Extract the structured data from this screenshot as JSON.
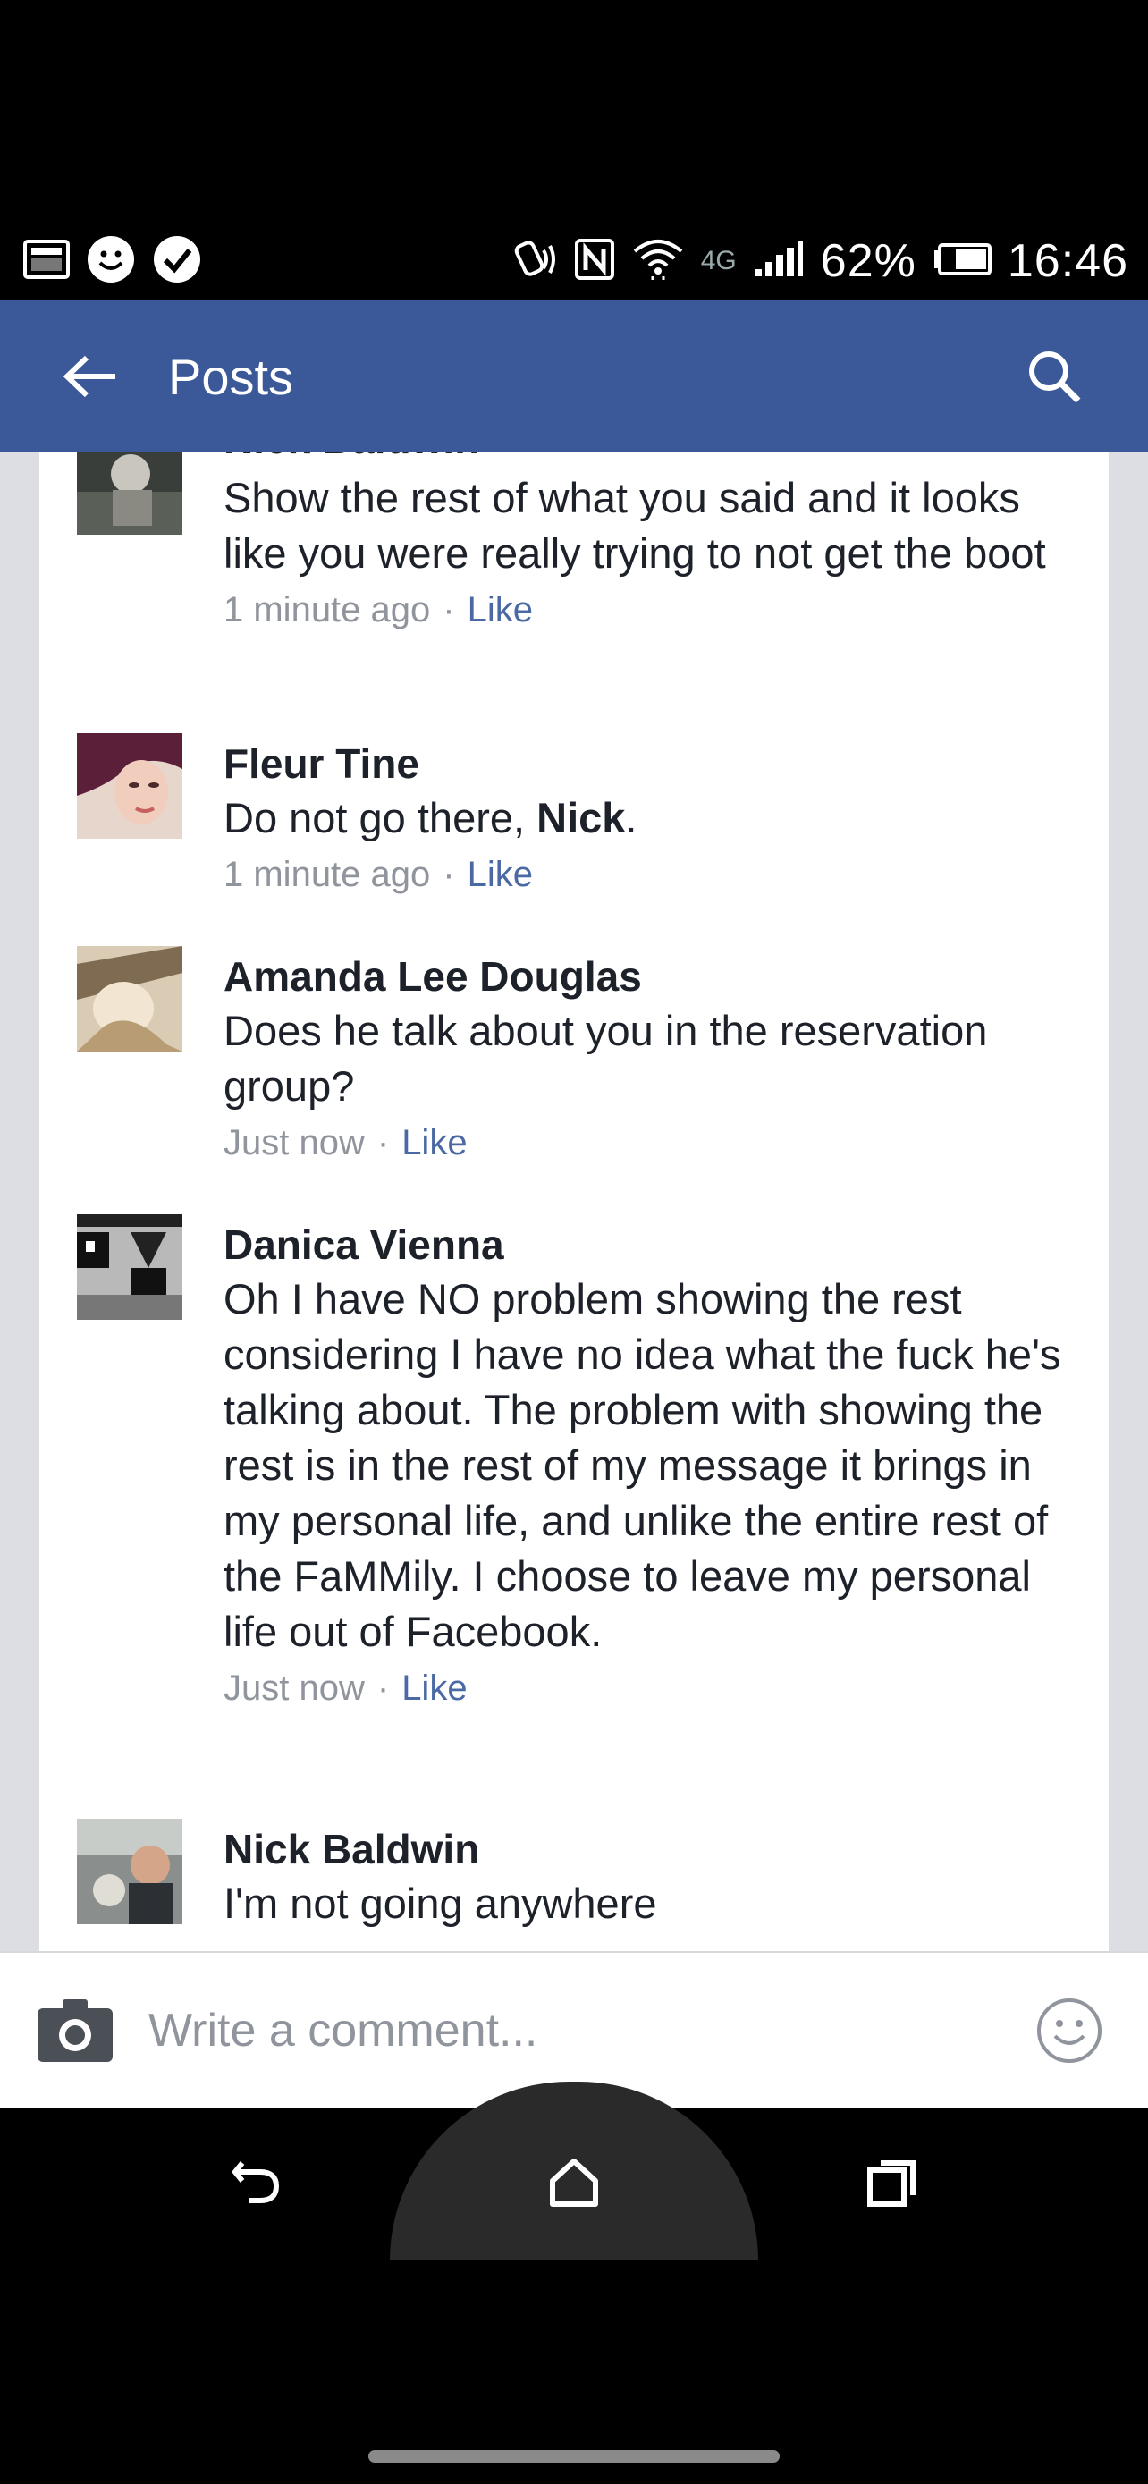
{
  "status_bar": {
    "network": "4G",
    "battery": "62%",
    "time": "16:46"
  },
  "app_bar": {
    "title": "Posts",
    "icons": [
      "back-arrow-icon",
      "search-icon"
    ]
  },
  "comments": [
    {
      "name": "Nick Baldwin",
      "text": "Show the rest of what you said and it looks like you were really trying to not get the boot",
      "time": "1 minute ago",
      "like": "Like"
    },
    {
      "name": "Fleur Tine",
      "text": "Do not go there,",
      "mention": "Nick",
      "text_end": ".",
      "time": "1 minute ago",
      "like": "Like"
    },
    {
      "name": "Amanda Lee Douglas",
      "text": "Does he talk about you in the reservation group?",
      "time": "Just now",
      "like": "Like"
    },
    {
      "name": "Danica Vienna",
      "text": "Oh I have NO problem showing the rest considering I have no idea what the fuck he's talking about. The problem with showing the rest is in the rest of my message it brings in my personal life, and unlike the entire rest of the FaMMily. I choose to leave my personal life out of Facebook.",
      "time": "Just now",
      "like": "Like"
    },
    {
      "name": "Nick Baldwin",
      "text": "I'm not going anywhere"
    }
  ],
  "comment_input": {
    "placeholder": "Write a comment..."
  },
  "colors": {
    "brand_blue": "#3b5998",
    "link_blue": "#4b6aa3",
    "meta_gray": "#90949c"
  }
}
